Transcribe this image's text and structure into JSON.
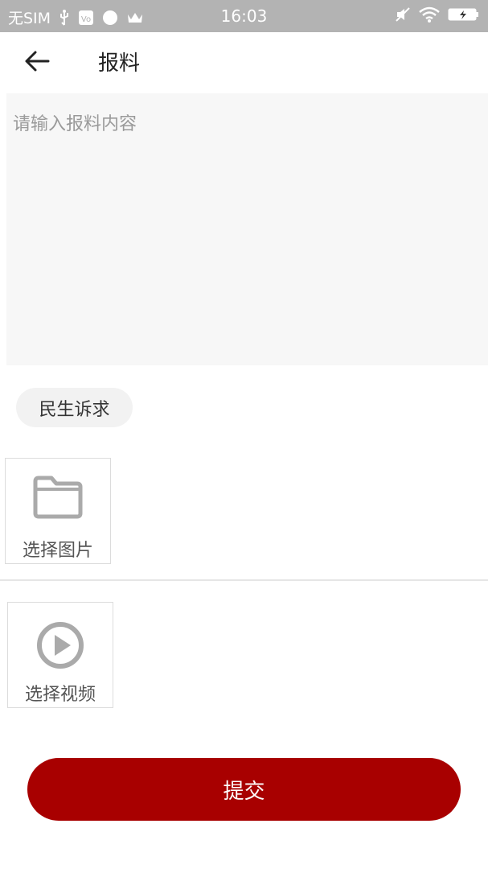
{
  "status_bar": {
    "carrier": "无SIM",
    "time": "16:03",
    "icons_left": [
      "usb-icon",
      "app-icon",
      "compass-icon",
      "crown-icon"
    ],
    "icons_right": [
      "mute-icon",
      "wifi-icon",
      "battery-charging-icon"
    ]
  },
  "toolbar": {
    "back_icon": "arrow-left-icon",
    "title": "报料"
  },
  "content_input": {
    "placeholder": "请输入报料内容",
    "value": ""
  },
  "category": {
    "label": "民生诉求"
  },
  "image_picker": {
    "icon": "folder-icon",
    "label": "选择图片"
  },
  "video_picker": {
    "icon": "play-circle-icon",
    "label": "选择视频"
  },
  "submit": {
    "label": "提交"
  },
  "colors": {
    "status_bar": "#b3b3b3",
    "accent": "#a80000",
    "input_bg": "#f7f7f7",
    "chip_bg": "#f2f2f2",
    "icon_gray": "#aaaaaa"
  }
}
